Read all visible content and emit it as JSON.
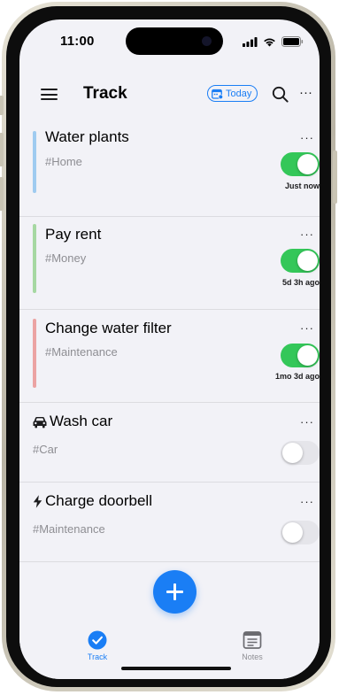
{
  "status_bar": {
    "time": "11:00"
  },
  "header": {
    "title": "Track",
    "today_label": "Today",
    "more_label": "···"
  },
  "colors": {
    "accent": "#1a7ef5",
    "toggle_on": "#34c759",
    "toggle_off": "#e5e5ea",
    "bar_home": "#9fcbf0",
    "bar_money": "#a6d8a2",
    "bar_maintenance": "#eba3a3"
  },
  "items": [
    {
      "title": "Water plants",
      "tag": "#Home",
      "enabled": true,
      "time": "Just now",
      "bar_color": "#9fcbf0",
      "more": "···"
    },
    {
      "title": "Pay rent",
      "tag": "#Money",
      "enabled": true,
      "time": "5d 3h ago",
      "bar_color": "#a6d8a2",
      "more": "···"
    },
    {
      "title": "Change water filter",
      "tag": "#Maintenance",
      "enabled": true,
      "time": "1mo 3d ago",
      "bar_color": "#eba3a3",
      "more": "···"
    },
    {
      "title": "Wash car",
      "tag": "#Car",
      "enabled": false,
      "icon": "car-icon",
      "more": "···"
    },
    {
      "title": "Charge doorbell",
      "tag": "#Maintenance",
      "enabled": false,
      "icon": "lightning-bolt-icon",
      "more": "···"
    }
  ],
  "tabbar": {
    "tabs": [
      {
        "label": "Track",
        "icon": "checkmark-circle-icon",
        "active": true
      },
      {
        "label": "Notes",
        "icon": "notes-icon",
        "active": false
      }
    ]
  }
}
